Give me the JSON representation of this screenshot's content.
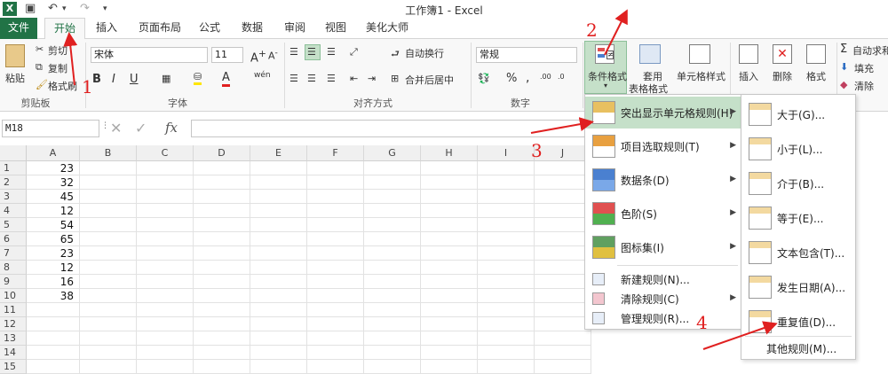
{
  "window": {
    "title": "工作簿1 - Excel",
    "app_logo": "X"
  },
  "tabs": [
    "文件",
    "开始",
    "插入",
    "页面布局",
    "公式",
    "数据",
    "审阅",
    "视图",
    "美化大师"
  ],
  "clipboard": {
    "paste": "粘贴",
    "cut": "剪切",
    "copy": "复制",
    "format_painter": "格式刷",
    "group": "剪贴板"
  },
  "font": {
    "name": "宋体",
    "size": "11",
    "bold": "B",
    "italic": "I",
    "underline": "U",
    "font_color": "A",
    "phonetic": "wén",
    "group": "字体"
  },
  "alignment": {
    "wrap": "自动换行",
    "merge": "合并后居中",
    "group": "对齐方式"
  },
  "number": {
    "format": "常规",
    "percent": "%",
    "comma": ",",
    "group": "数字"
  },
  "styles": {
    "conditional": "条件格式",
    "table_line1": "套用",
    "table_line2": "表格格式",
    "cell_styles": "单元格样式"
  },
  "cells": {
    "insert": "插入",
    "delete": "删除",
    "format": "格式"
  },
  "editing": {
    "autosum": "自动求和",
    "fill": "填充",
    "clear": "清除"
  },
  "formula_bar": {
    "name_box": "M18",
    "fx": "fx",
    "value": ""
  },
  "columns": [
    "A",
    "B",
    "C",
    "D",
    "E",
    "F",
    "G",
    "H",
    "I",
    "J"
  ],
  "rows": [
    "1",
    "2",
    "3",
    "4",
    "5",
    "6",
    "7",
    "8",
    "9",
    "10",
    "11",
    "12",
    "13",
    "14",
    "15"
  ],
  "column_a_values": [
    "23",
    "32",
    "45",
    "12",
    "54",
    "65",
    "23",
    "12",
    "16",
    "38"
  ],
  "menu_main": [
    {
      "label": "突出显示单元格规则(H)",
      "submenu": true
    },
    {
      "label": "项目选取规则(T)",
      "submenu": true
    },
    {
      "label": "数据条(D)",
      "submenu": true
    },
    {
      "label": "色阶(S)",
      "submenu": true
    },
    {
      "label": "图标集(I)",
      "submenu": true
    },
    {
      "label": "新建规则(N)...",
      "submenu": false
    },
    {
      "label": "清除规则(C)",
      "submenu": true
    },
    {
      "label": "管理规则(R)...",
      "submenu": false
    }
  ],
  "menu_sub": [
    "大于(G)...",
    "小于(L)...",
    "介于(B)...",
    "等于(E)...",
    "文本包含(T)...",
    "发生日期(A)...",
    "重复值(D)...",
    "其他规则(M)..."
  ],
  "annotations": [
    "1",
    "2",
    "3",
    "4"
  ],
  "accent": "#217346"
}
